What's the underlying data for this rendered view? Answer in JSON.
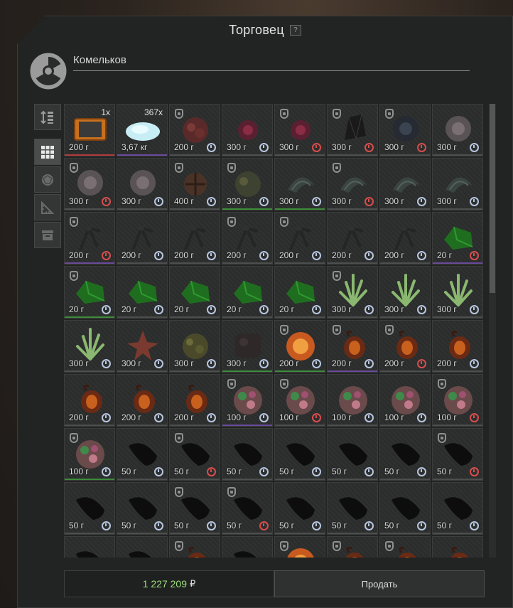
{
  "window": {
    "title": "Торговец",
    "help": "?"
  },
  "trader": {
    "name": "Комельков",
    "logo_icon": "radiation-icon"
  },
  "sidebar": {
    "items": [
      {
        "icon": "sort-icon",
        "active": false
      },
      {
        "icon": "grid-view-icon",
        "active": true
      },
      {
        "icon": "artifact-filter-icon",
        "active": false
      },
      {
        "icon": "ruler-filter-icon",
        "active": false
      },
      {
        "icon": "container-filter-icon",
        "active": false
      }
    ]
  },
  "colors": {
    "clock_normal": "#b8c6e0",
    "clock_expiring": "#d84d4d",
    "rarity_green": "#3d8c3a",
    "rarity_purple": "#6a4a9c",
    "rarity_red": "#b03a3a",
    "total_value": "#9ee07d"
  },
  "items": [
    {
      "price": "200 г",
      "qty": "1x",
      "art": "tablet",
      "rar": "red"
    },
    {
      "price": "3,67 кг",
      "qty": "367x",
      "art": "salt",
      "rar": "purple"
    },
    {
      "price": "200 г",
      "art": "ore-red",
      "shield": true,
      "clock": "normal"
    },
    {
      "price": "300 г",
      "art": "flower-red",
      "clock": "normal"
    },
    {
      "price": "300 г",
      "art": "flower-red",
      "shield": true,
      "clock": "red"
    },
    {
      "price": "300 г",
      "art": "black-crystal",
      "shield": true,
      "clock": "red"
    },
    {
      "price": "300 г",
      "art": "black-rose",
      "shield": true,
      "clock": "red"
    },
    {
      "price": "300 г",
      "art": "grey-rose",
      "clock": "normal"
    },
    {
      "price": "300 г",
      "art": "grey-rose",
      "shield": true,
      "clock": "red"
    },
    {
      "price": "300 г",
      "art": "grey-rose",
      "clock": "normal"
    },
    {
      "price": "400 г",
      "art": "brown-ball",
      "shield": true,
      "clock": "normal"
    },
    {
      "price": "300 г",
      "art": "moss",
      "shield": true,
      "clock": "normal",
      "rar": "green"
    },
    {
      "price": "300 г",
      "art": "shell",
      "clock": "normal",
      "rar": "green"
    },
    {
      "price": "300 г",
      "art": "shell",
      "shield": true,
      "clock": "red"
    },
    {
      "price": "300 г",
      "art": "shell",
      "clock": "normal"
    },
    {
      "price": "300 г",
      "art": "shell",
      "clock": "normal"
    },
    {
      "price": "200 г",
      "art": "twig",
      "shield": true,
      "clock": "red",
      "rar": "purple"
    },
    {
      "price": "200 г",
      "art": "twig",
      "clock": "normal"
    },
    {
      "price": "200 г",
      "art": "twig",
      "clock": "normal"
    },
    {
      "price": "200 г",
      "art": "twig",
      "shield": true,
      "clock": "normal"
    },
    {
      "price": "200 г",
      "art": "twig",
      "shield": true,
      "clock": "normal"
    },
    {
      "price": "200 г",
      "art": "twig",
      "clock": "normal"
    },
    {
      "price": "200 г",
      "art": "twig",
      "clock": "normal"
    },
    {
      "price": "20 г",
      "art": "green-gem",
      "clock": "red",
      "rar": "purple"
    },
    {
      "price": "20 г",
      "art": "green-gem",
      "shield": true,
      "clock": "normal",
      "rar": "green"
    },
    {
      "price": "20 г",
      "art": "green-gem",
      "clock": "normal"
    },
    {
      "price": "20 г",
      "art": "green-gem",
      "clock": "normal"
    },
    {
      "price": "20 г",
      "art": "green-gem",
      "clock": "normal"
    },
    {
      "price": "20 г",
      "art": "green-gem",
      "clock": "normal"
    },
    {
      "price": "300 г",
      "art": "green-crystal",
      "shield": true,
      "clock": "normal"
    },
    {
      "price": "300 г",
      "art": "green-crystal",
      "clock": "normal"
    },
    {
      "price": "300 г",
      "art": "green-crystal",
      "clock": "normal"
    },
    {
      "price": "300 г",
      "art": "green-crystal",
      "clock": "normal"
    },
    {
      "price": "300 г",
      "art": "star-red",
      "clock": "normal"
    },
    {
      "price": "300 г",
      "art": "moss-ball",
      "clock": "normal"
    },
    {
      "price": "300 г",
      "art": "dark-rock",
      "clock": "normal",
      "rar": "green"
    },
    {
      "price": "200 г",
      "art": "fire-orb",
      "shield": true,
      "clock": "normal",
      "rar": "green"
    },
    {
      "price": "200 г",
      "art": "amber",
      "shield": true,
      "clock": "normal",
      "rar": "purple"
    },
    {
      "price": "200 г",
      "art": "amber",
      "shield": true,
      "clock": "red"
    },
    {
      "price": "200 г",
      "art": "amber",
      "clock": "normal"
    },
    {
      "price": "200 г",
      "art": "amber",
      "clock": "normal"
    },
    {
      "price": "200 г",
      "art": "amber",
      "clock": "normal"
    },
    {
      "price": "200 г",
      "art": "amber",
      "clock": "normal"
    },
    {
      "price": "100 г",
      "art": "flower-mix",
      "shield": true,
      "clock": "normal",
      "rar": "purple"
    },
    {
      "price": "100 г",
      "art": "flower-mix",
      "shield": true,
      "clock": "red"
    },
    {
      "price": "100 г",
      "art": "flower-mix",
      "clock": "normal"
    },
    {
      "price": "100 г",
      "art": "flower-mix",
      "clock": "normal"
    },
    {
      "price": "100 г",
      "art": "flower-mix",
      "shield": true,
      "clock": "red"
    },
    {
      "price": "100 г",
      "art": "flower-mix",
      "shield": true,
      "clock": "normal",
      "rar": "green"
    },
    {
      "price": "50 г",
      "art": "black-leaf",
      "clock": "normal"
    },
    {
      "price": "50 г",
      "art": "black-leaf",
      "shield": true,
      "clock": "red"
    },
    {
      "price": "50 г",
      "art": "black-leaf",
      "clock": "normal"
    },
    {
      "price": "50 г",
      "art": "black-leaf",
      "clock": "normal"
    },
    {
      "price": "50 г",
      "art": "black-leaf",
      "clock": "normal"
    },
    {
      "price": "50 г",
      "art": "black-leaf",
      "clock": "normal"
    },
    {
      "price": "50 г",
      "art": "black-leaf",
      "shield": true,
      "clock": "red"
    },
    {
      "price": "50 г",
      "art": "black-leaf",
      "clock": "normal"
    },
    {
      "price": "50 г",
      "art": "black-leaf",
      "clock": "normal"
    },
    {
      "price": "50 г",
      "art": "black-leaf",
      "shield": true,
      "clock": "normal"
    },
    {
      "price": "50 г",
      "art": "black-leaf",
      "shield": true,
      "clock": "red"
    },
    {
      "price": "50 г",
      "art": "black-leaf",
      "clock": "normal"
    },
    {
      "price": "50 г",
      "art": "black-leaf",
      "clock": "normal"
    },
    {
      "price": "50 г",
      "art": "black-leaf",
      "clock": "normal"
    },
    {
      "price": "50 г",
      "art": "black-leaf",
      "clock": "normal"
    },
    {
      "price": "",
      "art": "black-leaf"
    },
    {
      "price": "",
      "art": "black-leaf"
    },
    {
      "price": "",
      "art": "amber",
      "shield": true
    },
    {
      "price": "",
      "art": "black-leaf"
    },
    {
      "price": "",
      "art": "fire-orb",
      "shield": true
    },
    {
      "price": "",
      "art": "amber",
      "shield": true
    },
    {
      "price": "",
      "art": "amber",
      "shield": true
    },
    {
      "price": "",
      "art": "amber"
    }
  ],
  "footer": {
    "total": "1 227 209",
    "currency": "₽",
    "sell_label": "Продать"
  }
}
